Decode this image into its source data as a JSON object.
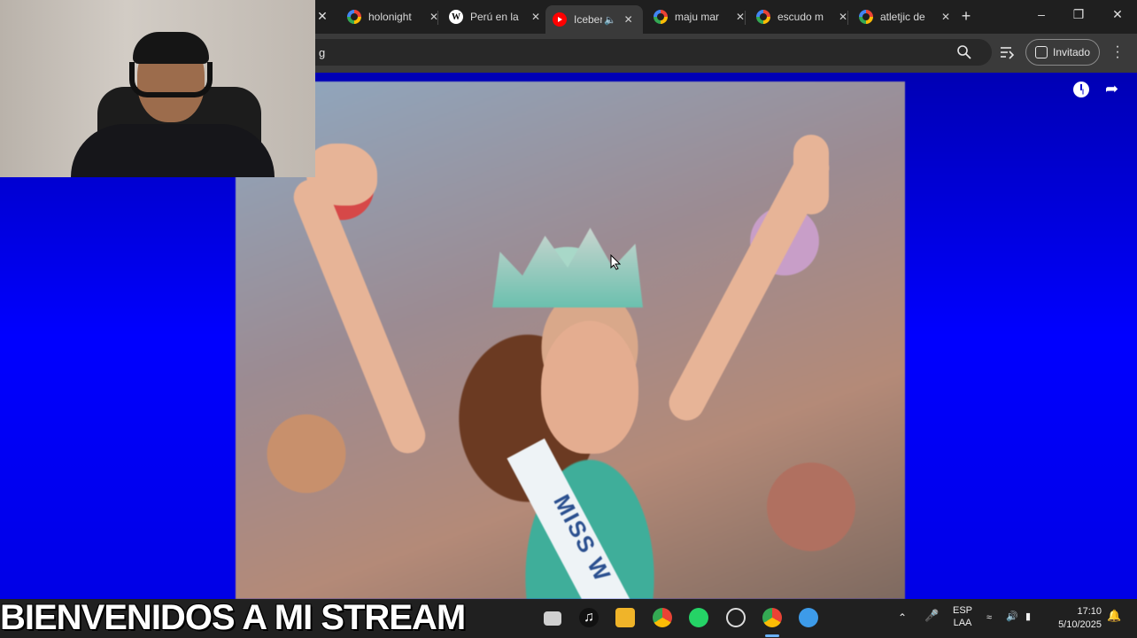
{
  "browser": {
    "tabs": [
      {
        "title": "holonight",
        "favicon": "google-icon"
      },
      {
        "title": "Perú en la",
        "favicon": "wikipedia-icon"
      },
      {
        "title": "Iceber",
        "favicon": "youtube-icon",
        "active": true,
        "audio": true
      },
      {
        "title": "maju mar",
        "favicon": "google-icon"
      },
      {
        "title": "escudo m",
        "favicon": "google-icon"
      },
      {
        "title": "atletjic de",
        "favicon": "google-icon"
      }
    ],
    "new_tab_glyph": "+",
    "address_text": "g",
    "profile_label": "Invitado"
  },
  "video": {
    "sash_text": "MISS W"
  },
  "overlay": {
    "banner_text": "BIENVENIDOS A MI STREAM"
  },
  "taskbar": {
    "language_top": "ESP",
    "language_bottom": "LAA",
    "time": "17:10",
    "date": "5/10/2025"
  },
  "colors": {
    "page_background": "#0000ff",
    "tab_strip": "#1f1f1f",
    "active_tab": "#3a3a3a",
    "taskbar": "#202020"
  }
}
